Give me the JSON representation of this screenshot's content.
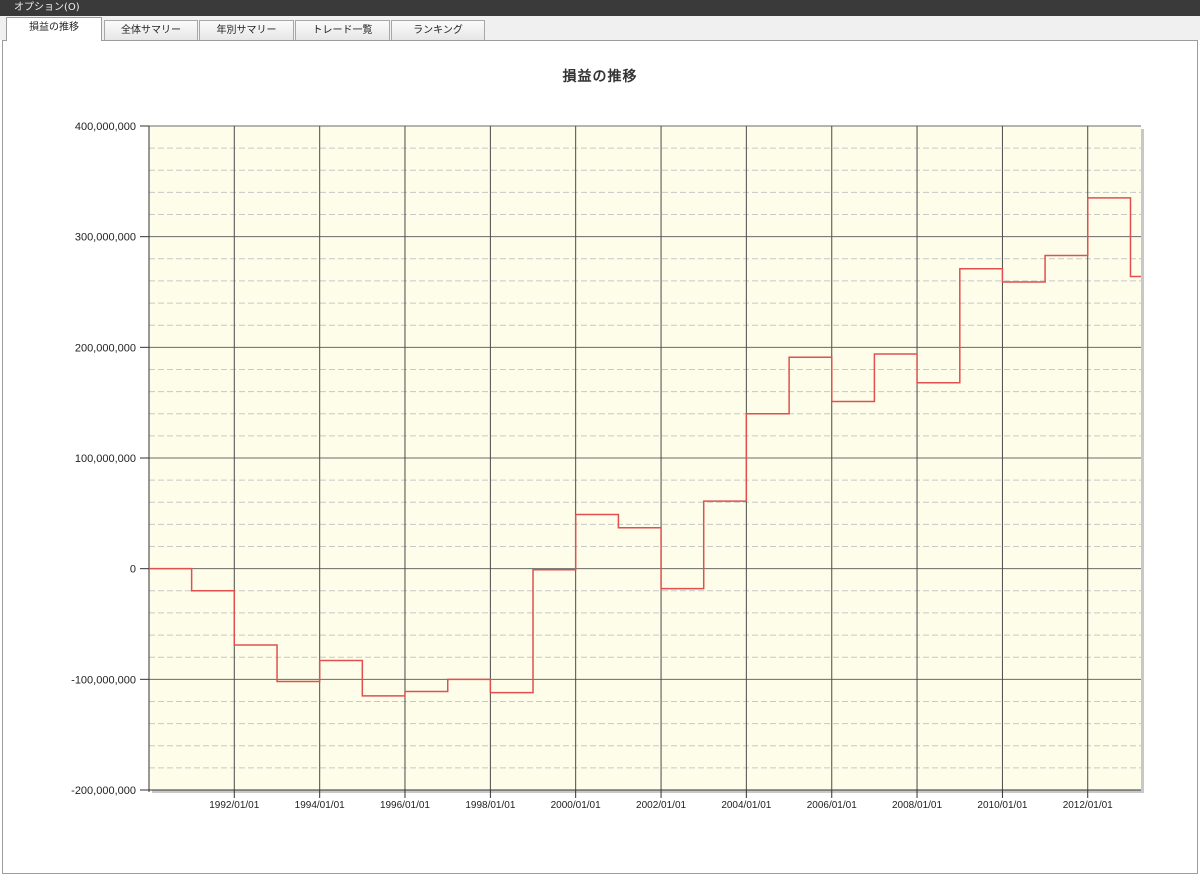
{
  "window": {
    "title": "オプション(O)"
  },
  "tabs": [
    {
      "label": "損益の推移",
      "active": true
    },
    {
      "label": "全体サマリー",
      "active": false
    },
    {
      "label": "年別サマリー",
      "active": false
    },
    {
      "label": "トレード一覧",
      "active": false
    },
    {
      "label": "ランキング",
      "active": false
    }
  ],
  "colors": {
    "plot_bg": "#fdfde9",
    "line": "#e05050"
  },
  "chart_data": {
    "type": "line",
    "step": true,
    "title": "損益の推移",
    "xlabel": "",
    "ylabel": "",
    "ylim": [
      -200000000,
      400000000
    ],
    "xlim": [
      "1990-01-01",
      "2013-04-01"
    ],
    "grid": true,
    "yticks": [
      {
        "value": 400000000,
        "label": "400,000,000"
      },
      {
        "value": 300000000,
        "label": "300,000,000"
      },
      {
        "value": 200000000,
        "label": "200,000,000"
      },
      {
        "value": 100000000,
        "label": "100,000,000"
      },
      {
        "value": 0,
        "label": "0"
      },
      {
        "value": -100000000,
        "label": "-100,000,000"
      },
      {
        "value": -200000000,
        "label": "-200,000,000"
      }
    ],
    "xticks": [
      {
        "value": "1992-01-01",
        "label": "1992/01/01"
      },
      {
        "value": "1994-01-01",
        "label": "1994/01/01"
      },
      {
        "value": "1996-01-01",
        "label": "1996/01/01"
      },
      {
        "value": "1998-01-01",
        "label": "1998/01/01"
      },
      {
        "value": "2000-01-01",
        "label": "2000/01/01"
      },
      {
        "value": "2002-01-01",
        "label": "2002/01/01"
      },
      {
        "value": "2004-01-01",
        "label": "2004/01/01"
      },
      {
        "value": "2006-01-01",
        "label": "2006/01/01"
      },
      {
        "value": "2008-01-01",
        "label": "2008/01/01"
      },
      {
        "value": "2010-01-01",
        "label": "2010/01/01"
      },
      {
        "value": "2012-01-01",
        "label": "2012/01/01"
      }
    ],
    "series": [
      {
        "x": [
          "1990-01-01",
          "1991-01-01",
          "1992-01-01",
          "1993-01-01",
          "1994-01-01",
          "1995-01-01",
          "1996-01-01",
          "1997-01-01",
          "1998-01-01",
          "1999-01-01",
          "2000-01-01",
          "2001-01-01",
          "2002-01-01",
          "2003-01-01",
          "2004-01-01",
          "2005-01-01",
          "2006-01-01",
          "2007-01-01",
          "2008-01-01",
          "2009-01-01",
          "2010-01-01",
          "2011-01-01",
          "2012-01-01",
          "2013-01-01"
        ],
        "values": [
          0,
          -20000000,
          -69000000,
          -102000000,
          -83000000,
          -115000000,
          -111000000,
          -100000000,
          -112000000,
          -1000000,
          49000000,
          37000000,
          -18000000,
          61000000,
          140000000,
          191000000,
          151000000,
          194000000,
          168000000,
          271000000,
          259000000,
          283000000,
          335000000,
          264000000
        ]
      }
    ]
  }
}
